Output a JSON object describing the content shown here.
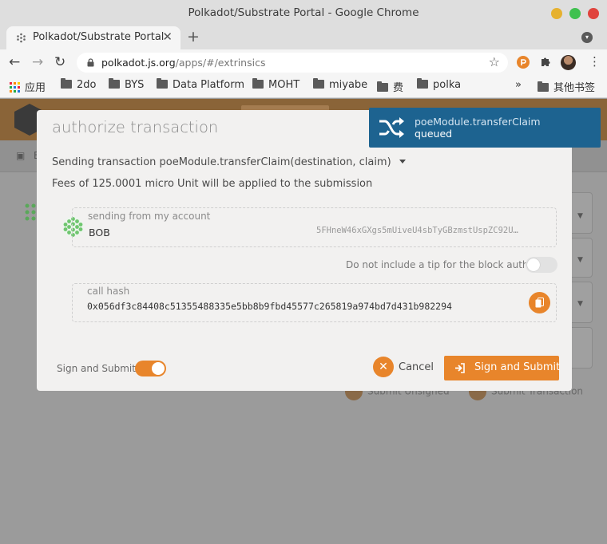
{
  "window": {
    "title": "Polkadot/Substrate Portal - Google Chrome"
  },
  "tab": {
    "title": "Polkadot/Substrate Portal",
    "close": "✕",
    "new": "+"
  },
  "address": {
    "host": "polkadot.js.org",
    "path": "/apps/#/extrinsics"
  },
  "bookmarks": [
    {
      "label": "应用"
    },
    {
      "label": "2do"
    },
    {
      "label": "BYS"
    },
    {
      "label": "Data Platform"
    },
    {
      "label": "MOHT"
    },
    {
      "label": "miyabe"
    },
    {
      "label": "费"
    },
    {
      "label": "polka"
    }
  ],
  "bookmarks_more": "»",
  "bookmarks_other": "其他书签",
  "background": {
    "subnav_text": "E",
    "field_label_snippet": "t",
    "submit_unsigned": "Submit Unsigned",
    "submit_transaction": "Submit Transaction"
  },
  "modal": {
    "title": "authorize transaction",
    "sending_line": "Sending transaction poeModule.transferClaim(destination, claim)",
    "fees_line": "Fees of 125.0001 micro Unit will be applied to the submission",
    "account": {
      "label": "sending from my account",
      "name": "BOB",
      "address": "5FHneW46xGXgs5mUiveU4sbTyGBzmstUspZC92U…"
    },
    "tip": {
      "label": "Do not include a tip for the block author",
      "enabled": false
    },
    "call_hash": {
      "label": "call hash",
      "value": "0x056df3c84408c51355488335e5bb8b9fbd45577c265819a974bd7d431b982294"
    },
    "sign_toggle": {
      "label": "Sign and Submit",
      "enabled": true
    },
    "cancel_label": "Cancel",
    "submit_label": "Sign and Submit"
  },
  "notification": {
    "method": "poeModule.transferClaim",
    "status": "queued"
  },
  "colors": {
    "accent": "#e8852b",
    "notification": "#1d6390",
    "close": "#e0443e",
    "minimize": "#e6b12f",
    "maximize": "#3fc14f"
  },
  "icons": [
    "lock-icon",
    "star-icon",
    "puzzle-icon",
    "shuffle-icon",
    "copy-icon",
    "x-icon",
    "sign-in-icon",
    "apps-grid-icon"
  ]
}
